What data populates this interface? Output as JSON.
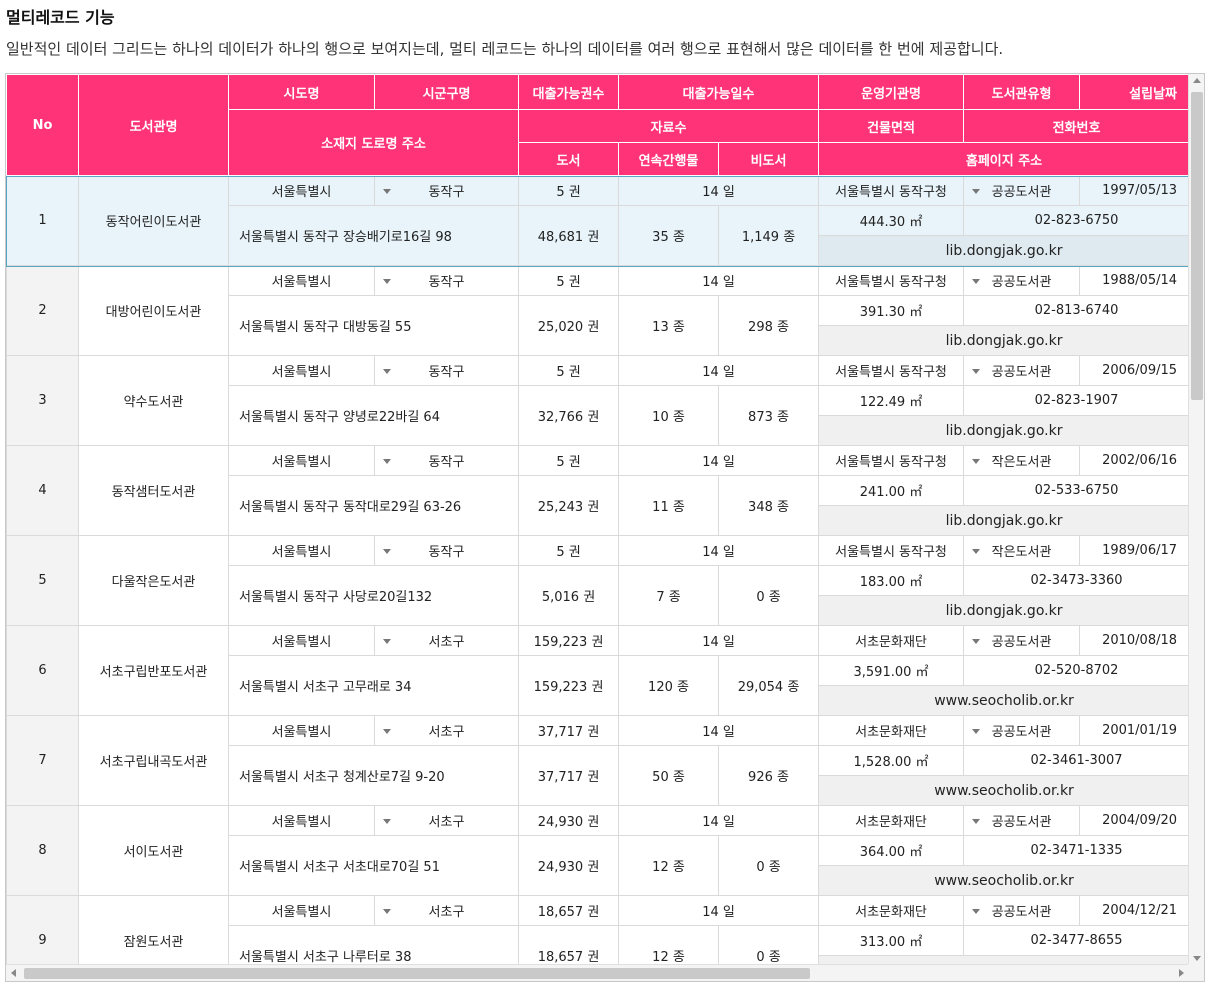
{
  "page": {
    "title": "멀티레코드 기능",
    "description": "일반적인 데이터 그리드는 하나의 데이터가 하나의 행으로 보여지는데, 멀티 레코드는 하나의 데이터를 여러 행으로 표현해서 많은 데이터를 한 번에 제공합니다."
  },
  "colors": {
    "header_bg": "#ff3377",
    "selected_row": "#e8f4fa",
    "selected_border": "#5aa6c2"
  },
  "headers": {
    "no": "No",
    "name": "도서관명",
    "sido": "시도명",
    "sigungu": "시군구명",
    "loan_books": "대출가능권수",
    "loan_days": "대출가능일수",
    "operator": "운영기관명",
    "lib_type": "도서관유형",
    "est_date": "설립날짜",
    "address": "소재지 도로명 주소",
    "materials": "자료수",
    "area": "건물면적",
    "phone": "전화번호",
    "books": "도서",
    "serials": "연속간행물",
    "nonbooks": "비도서",
    "homepage": "홈페이지 주소"
  },
  "rows": [
    {
      "no": "1",
      "name": "동작어린이도서관",
      "sido": "서울특별시",
      "sigungu": "동작구",
      "loan_books": "5 권",
      "loan_days": "14 일",
      "operator": "서울특별시 동작구청",
      "lib_type": "공공도서관",
      "est_date": "1997/05/13",
      "address": "서울특별시 동작구 장승배기로16길 98",
      "books": "48,681 권",
      "serials": "35 종",
      "nonbooks": "1,149 종",
      "area": "444.30 ㎡",
      "phone": "02-823-6750",
      "homepage": "lib.dongjak.go.kr"
    },
    {
      "no": "2",
      "name": "대방어린이도서관",
      "sido": "서울특별시",
      "sigungu": "동작구",
      "loan_books": "5 권",
      "loan_days": "14 일",
      "operator": "서울특별시 동작구청",
      "lib_type": "공공도서관",
      "est_date": "1988/05/14",
      "address": "서울특별시 동작구 대방동길 55",
      "books": "25,020 권",
      "serials": "13 종",
      "nonbooks": "298 종",
      "area": "391.30 ㎡",
      "phone": "02-813-6740",
      "homepage": "lib.dongjak.go.kr"
    },
    {
      "no": "3",
      "name": "약수도서관",
      "sido": "서울특별시",
      "sigungu": "동작구",
      "loan_books": "5 권",
      "loan_days": "14 일",
      "operator": "서울특별시 동작구청",
      "lib_type": "공공도서관",
      "est_date": "2006/09/15",
      "address": "서울특별시 동작구 양녕로22바길 64",
      "books": "32,766 권",
      "serials": "10 종",
      "nonbooks": "873 종",
      "area": "122.49 ㎡",
      "phone": "02-823-1907",
      "homepage": "lib.dongjak.go.kr"
    },
    {
      "no": "4",
      "name": "동작샘터도서관",
      "sido": "서울특별시",
      "sigungu": "동작구",
      "loan_books": "5 권",
      "loan_days": "14 일",
      "operator": "서울특별시 동작구청",
      "lib_type": "작은도서관",
      "est_date": "2002/06/16",
      "address": "서울특별시 동작구 동작대로29길 63-26",
      "books": "25,243 권",
      "serials": "11 종",
      "nonbooks": "348 종",
      "area": "241.00 ㎡",
      "phone": "02-533-6750",
      "homepage": "lib.dongjak.go.kr"
    },
    {
      "no": "5",
      "name": "다울작은도서관",
      "sido": "서울특별시",
      "sigungu": "동작구",
      "loan_books": "5 권",
      "loan_days": "14 일",
      "operator": "서울특별시 동작구청",
      "lib_type": "작은도서관",
      "est_date": "1989/06/17",
      "address": "서울특별시 동작구 사당로20길132",
      "books": "5,016 권",
      "serials": "7 종",
      "nonbooks": "0 종",
      "area": "183.00 ㎡",
      "phone": "02-3473-3360",
      "homepage": "lib.dongjak.go.kr"
    },
    {
      "no": "6",
      "name": "서초구립반포도서관",
      "sido": "서울특별시",
      "sigungu": "서초구",
      "loan_books": "159,223 권",
      "loan_days": "14 일",
      "operator": "서초문화재단",
      "lib_type": "공공도서관",
      "est_date": "2010/08/18",
      "address": "서울특별시 서초구 고무래로 34",
      "books": "159,223 권",
      "serials": "120 종",
      "nonbooks": "29,054 종",
      "area": "3,591.00 ㎡",
      "phone": "02-520-8702",
      "homepage": "www.seocholib.or.kr"
    },
    {
      "no": "7",
      "name": "서초구립내곡도서관",
      "sido": "서울특별시",
      "sigungu": "서초구",
      "loan_books": "37,717 권",
      "loan_days": "14 일",
      "operator": "서초문화재단",
      "lib_type": "공공도서관",
      "est_date": "2001/01/19",
      "address": "서울특별시 서초구 청계산로7길 9-20",
      "books": "37,717 권",
      "serials": "50 종",
      "nonbooks": "926 종",
      "area": "1,528.00 ㎡",
      "phone": "02-3461-3007",
      "homepage": "www.seocholib.or.kr"
    },
    {
      "no": "8",
      "name": "서이도서관",
      "sido": "서울특별시",
      "sigungu": "서초구",
      "loan_books": "24,930 권",
      "loan_days": "14 일",
      "operator": "서초문화재단",
      "lib_type": "공공도서관",
      "est_date": "2004/09/20",
      "address": "서울특별시 서초구 서초대로70길 51",
      "books": "24,930 권",
      "serials": "12 종",
      "nonbooks": "0 종",
      "area": "364.00 ㎡",
      "phone": "02-3471-1335",
      "homepage": "www.seocholib.or.kr"
    },
    {
      "no": "9",
      "name": "잠원도서관",
      "sido": "서울특별시",
      "sigungu": "서초구",
      "loan_books": "18,657 권",
      "loan_days": "14 일",
      "operator": "서초문화재단",
      "lib_type": "공공도서관",
      "est_date": "2004/12/21",
      "address": "서울특별시 서초구 나루터로 38",
      "books": "18,657 권",
      "serials": "12 종",
      "nonbooks": "0 종",
      "area": "313.00 ㎡",
      "phone": "02-3477-8655",
      "homepage": ""
    }
  ]
}
